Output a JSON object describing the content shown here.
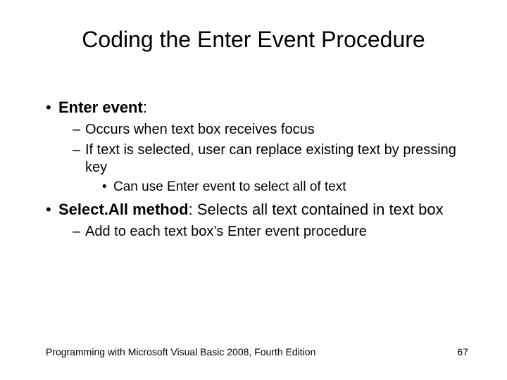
{
  "title": "Coding the Enter Event Procedure",
  "bullets": {
    "b1": {
      "label": "Enter event",
      "colon": ":"
    },
    "b1_1": "Occurs when text box receives focus",
    "b1_2": "If text is selected, user can replace existing text by pressing key",
    "b1_2_1": "Can use Enter event to select all of text",
    "b2": {
      "label": "Select.All method",
      "rest": ": Selects all text contained in text box"
    },
    "b2_1": "Add to each text box’s Enter event procedure"
  },
  "footer": {
    "left": "Programming with Microsoft Visual Basic 2008, Fourth Edition",
    "right": "67"
  }
}
